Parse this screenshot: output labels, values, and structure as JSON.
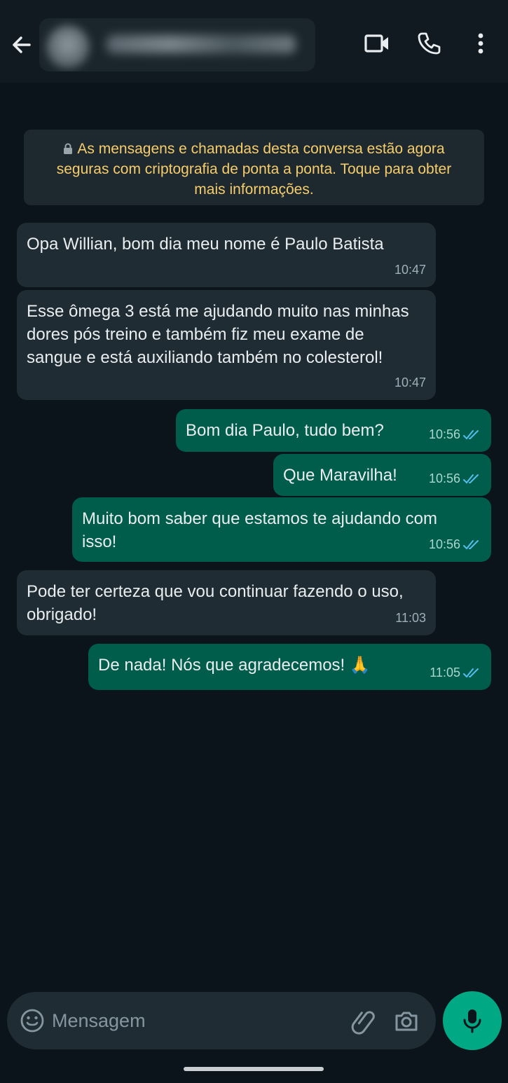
{
  "header": {
    "back_icon": "arrow-left-icon",
    "contact_blurred": true,
    "actions": [
      "video-camera-icon",
      "phone-icon",
      "more-vertical-icon"
    ]
  },
  "notice": {
    "icon": "lock-icon",
    "text": "As mensagens e chamadas desta conversa estão agora seguras com criptografia de ponta a ponta. Toque para obter mais informações."
  },
  "messages": [
    {
      "direction": "in",
      "text": "Opa Willian, bom dia meu nome é Paulo Batista",
      "time": "10:47"
    },
    {
      "direction": "in",
      "text": "Esse ômega 3 está me ajudando muito nas minhas dores pós treino e também fiz meu exame de sangue e está auxiliando também no colesterol!",
      "time": "10:47"
    },
    {
      "direction": "out",
      "text": "Bom dia Paulo, tudo bem?",
      "time": "10:56",
      "status": "read"
    },
    {
      "direction": "out",
      "text": "Que Maravilha!",
      "time": "10:56",
      "status": "read"
    },
    {
      "direction": "out",
      "text": "Muito bom saber que estamos te ajudando com isso!",
      "time": "10:56",
      "status": "read"
    },
    {
      "direction": "in",
      "text": "Pode ter certeza que vou continuar fazendo o uso, obrigado!",
      "time": "11:03"
    },
    {
      "direction": "out",
      "text": "De nada! Nós que agradecemos! 🙏",
      "time": "11:05",
      "status": "read"
    }
  ],
  "composer": {
    "placeholder": "Mensagem",
    "icons": [
      "emoji-icon",
      "paperclip-icon",
      "camera-icon",
      "microphone-icon"
    ]
  },
  "colors": {
    "background": "#0b141a",
    "incoming_bubble": "#1f2c34",
    "outgoing_bubble": "#005c4b",
    "accent": "#00a884",
    "notice_text": "#f7cd6b",
    "read_ticks": "#53bdeb"
  }
}
